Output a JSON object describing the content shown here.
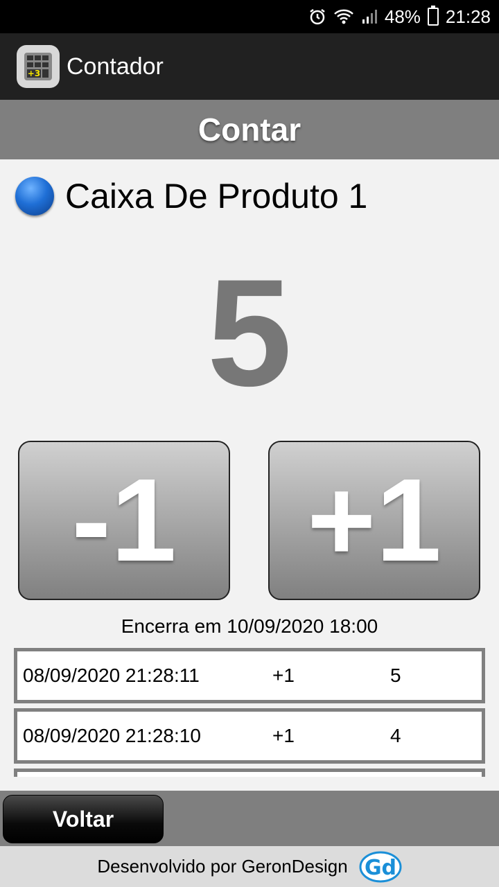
{
  "status_bar": {
    "battery": "48%",
    "time": "21:28",
    "icons": [
      "alarm-icon",
      "wifi-icon",
      "signal-icon",
      "battery-icon"
    ]
  },
  "app_bar": {
    "title": "Contador"
  },
  "section": {
    "title": "Contar"
  },
  "item": {
    "name": "Caixa De Produto 1",
    "color": "#1f6fd6",
    "count": "5"
  },
  "buttons": {
    "minus": "-1",
    "plus": "+1"
  },
  "ends_at": "Encerra em 10/09/2020 18:00",
  "history": [
    {
      "datetime": "08/09/2020 21:28:11",
      "delta": "+1",
      "total": "5"
    },
    {
      "datetime": "08/09/2020 21:28:10",
      "delta": "+1",
      "total": "4"
    }
  ],
  "back_button": "Voltar",
  "footer": {
    "text": "Desenvolvido por GeronDesign",
    "logo_text": "Gd"
  }
}
